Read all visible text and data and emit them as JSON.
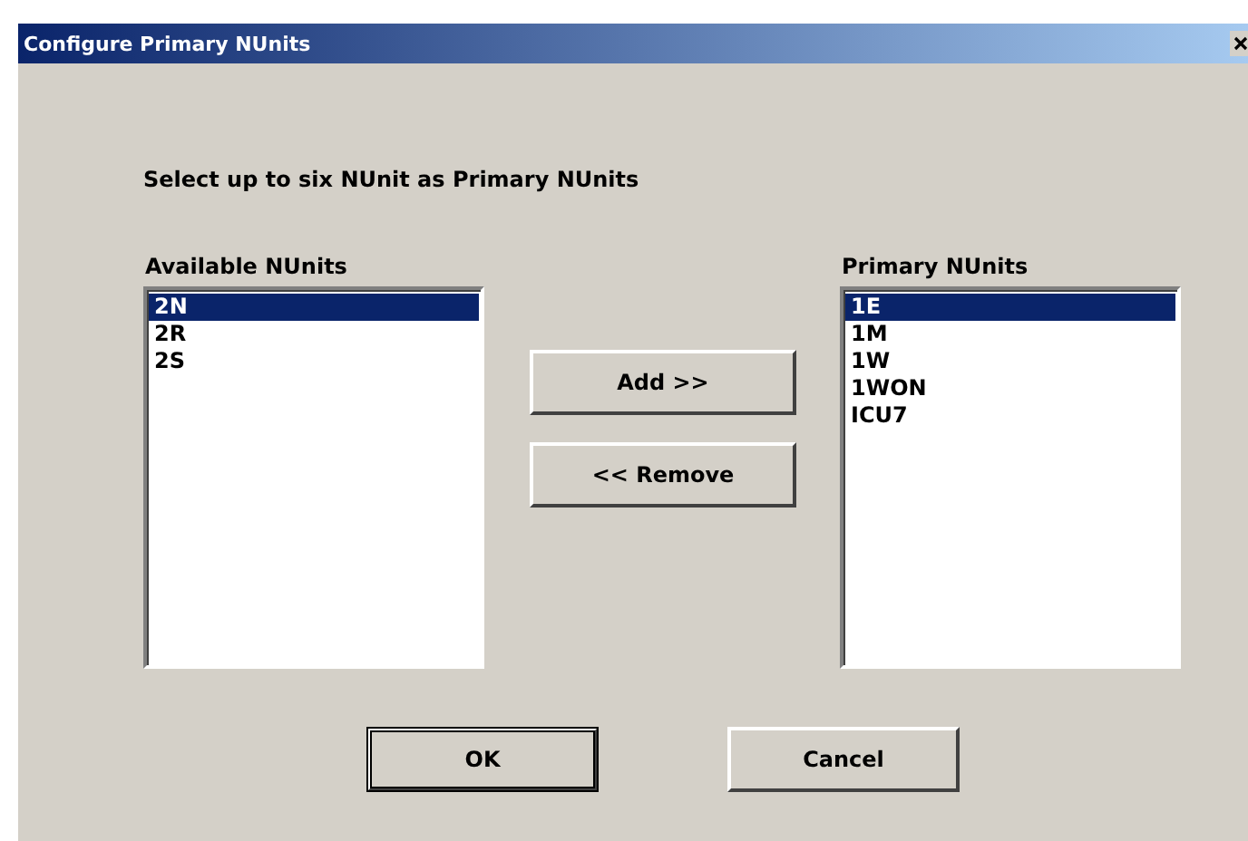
{
  "window": {
    "title": "Configure Primary NUnits"
  },
  "instruction": "Select up to six NUnit as Primary NUnits",
  "available": {
    "label": "Available NUnits",
    "items": [
      {
        "text": "2N",
        "selected": true
      },
      {
        "text": "2R",
        "selected": false
      },
      {
        "text": "2S",
        "selected": false
      }
    ]
  },
  "move_buttons": [
    "Add >>",
    "<< Remove"
  ],
  "primary": {
    "label": "Primary NUnits",
    "items": [
      {
        "text": "1E",
        "selected": true
      },
      {
        "text": "1M",
        "selected": false
      },
      {
        "text": "1W",
        "selected": false
      },
      {
        "text": "1WON",
        "selected": false
      },
      {
        "text": "ICU7",
        "selected": false
      }
    ]
  },
  "buttons": [
    {
      "label": "OK",
      "default": true
    },
    {
      "label": "Cancel",
      "default": false
    }
  ]
}
